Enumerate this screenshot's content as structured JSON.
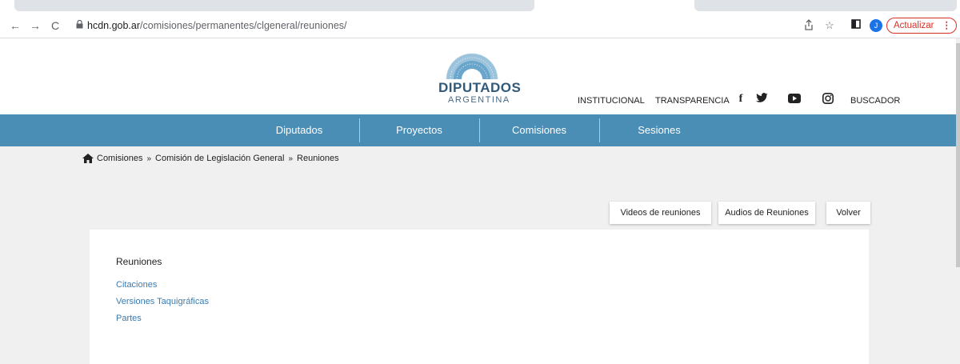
{
  "browser": {
    "url_domain": "hcdn.gob.ar",
    "url_path": "/comisiones/permanentes/clgeneral/reuniones/",
    "profile_initial": "J",
    "update_label": "Actualizar",
    "update_dots": "⋮"
  },
  "site": {
    "logo_title": "DIPUTADOS",
    "logo_subtitle": "ARGENTINA",
    "top_links": {
      "institucional": "INSTITUCIONAL",
      "transparencia": "TRANSPARENCIA",
      "buscador": "BUSCADOR"
    },
    "social": {
      "facebook": "f"
    },
    "brand_color": "#4a8eb6"
  },
  "main_nav": {
    "items": [
      "Diputados",
      "Proyectos",
      "Comisiones",
      "Sesiones"
    ]
  },
  "breadcrumb": {
    "items": [
      "Comisiones",
      "Comisión de Legislación General",
      "Reuniones"
    ],
    "separator": "»"
  },
  "actions": {
    "videos": "Videos de reuniones",
    "audios": "Audios de Reuniones",
    "back": "Volver"
  },
  "content": {
    "title": "Reuniones",
    "links": [
      "Citaciones",
      "Versiones Taquigráficas",
      "Partes"
    ]
  }
}
